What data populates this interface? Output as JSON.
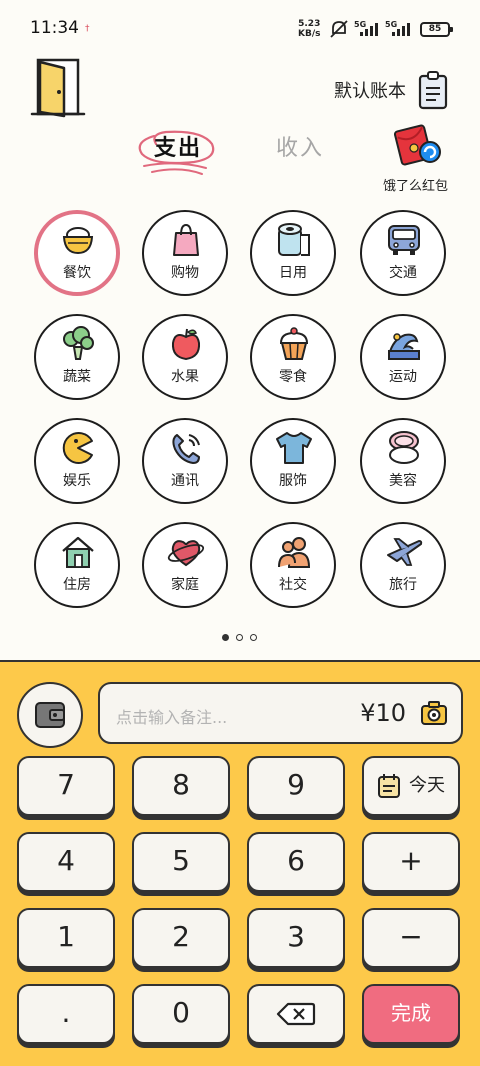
{
  "status_bar": {
    "time": "11:34",
    "notif": "†",
    "net_speed_value": "5.23",
    "net_speed_unit": "KB/s",
    "sim1": "5G",
    "sim2": "5G",
    "battery": "85"
  },
  "header": {
    "account_name": "默认账本",
    "tabs": {
      "expense": "支出",
      "income": "收入"
    },
    "promo_label": "饿了么红包"
  },
  "categories": [
    {
      "label": "餐饮",
      "icon": "rice-bowl-icon",
      "selected": true
    },
    {
      "label": "购物",
      "icon": "shopping-bag-icon"
    },
    {
      "label": "日用",
      "icon": "toilet-paper-icon"
    },
    {
      "label": "交通",
      "icon": "bus-icon"
    },
    {
      "label": "蔬菜",
      "icon": "broccoli-icon"
    },
    {
      "label": "水果",
      "icon": "apple-icon"
    },
    {
      "label": "零食",
      "icon": "cupcake-icon"
    },
    {
      "label": "运动",
      "icon": "surf-icon"
    },
    {
      "label": "娱乐",
      "icon": "pacman-icon"
    },
    {
      "label": "通讯",
      "icon": "phone-icon"
    },
    {
      "label": "服饰",
      "icon": "tshirt-icon"
    },
    {
      "label": "美容",
      "icon": "compact-mirror-icon"
    },
    {
      "label": "住房",
      "icon": "house-icon"
    },
    {
      "label": "家庭",
      "icon": "heart-planet-icon"
    },
    {
      "label": "社交",
      "icon": "people-icon"
    },
    {
      "label": "旅行",
      "icon": "airplane-icon"
    }
  ],
  "pager": {
    "pages": 3,
    "current": 1
  },
  "input": {
    "note_placeholder": "点击输入备注...",
    "amount": "¥10"
  },
  "keypad": {
    "k7": "7",
    "k8": "8",
    "k9": "9",
    "today": "今天",
    "k4": "4",
    "k5": "5",
    "k6": "6",
    "plus": "+",
    "k1": "1",
    "k2": "2",
    "k3": "3",
    "minus": "−",
    "dot": ".",
    "k0": "0",
    "done": "完成"
  },
  "colors": {
    "keypad_bg": "#fdc94a",
    "done_button": "#f06c80",
    "selected_ring": "#e27386",
    "inactive_tab": "#a6a6a6"
  }
}
